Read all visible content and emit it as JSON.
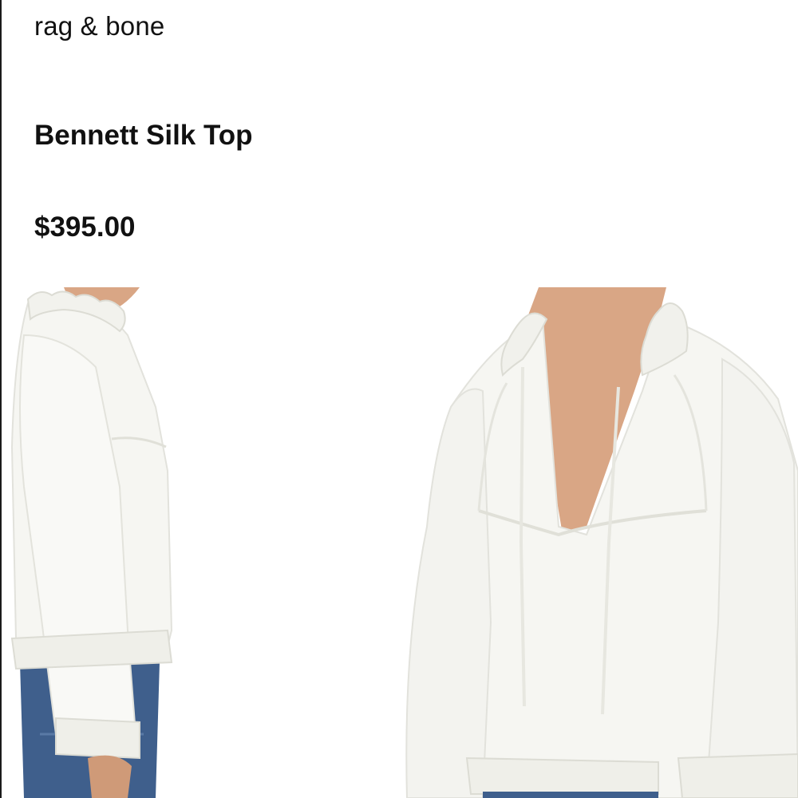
{
  "product": {
    "brand": "rag & bone",
    "name": "Bennett Silk Top",
    "price": "$395.00"
  },
  "colors": {
    "text": "#111111",
    "garment": "#f6f6f2",
    "skin": "#d8a583",
    "denim": "#3f5f8c"
  },
  "images": [
    {
      "view": "side profile"
    },
    {
      "view": "front"
    }
  ]
}
